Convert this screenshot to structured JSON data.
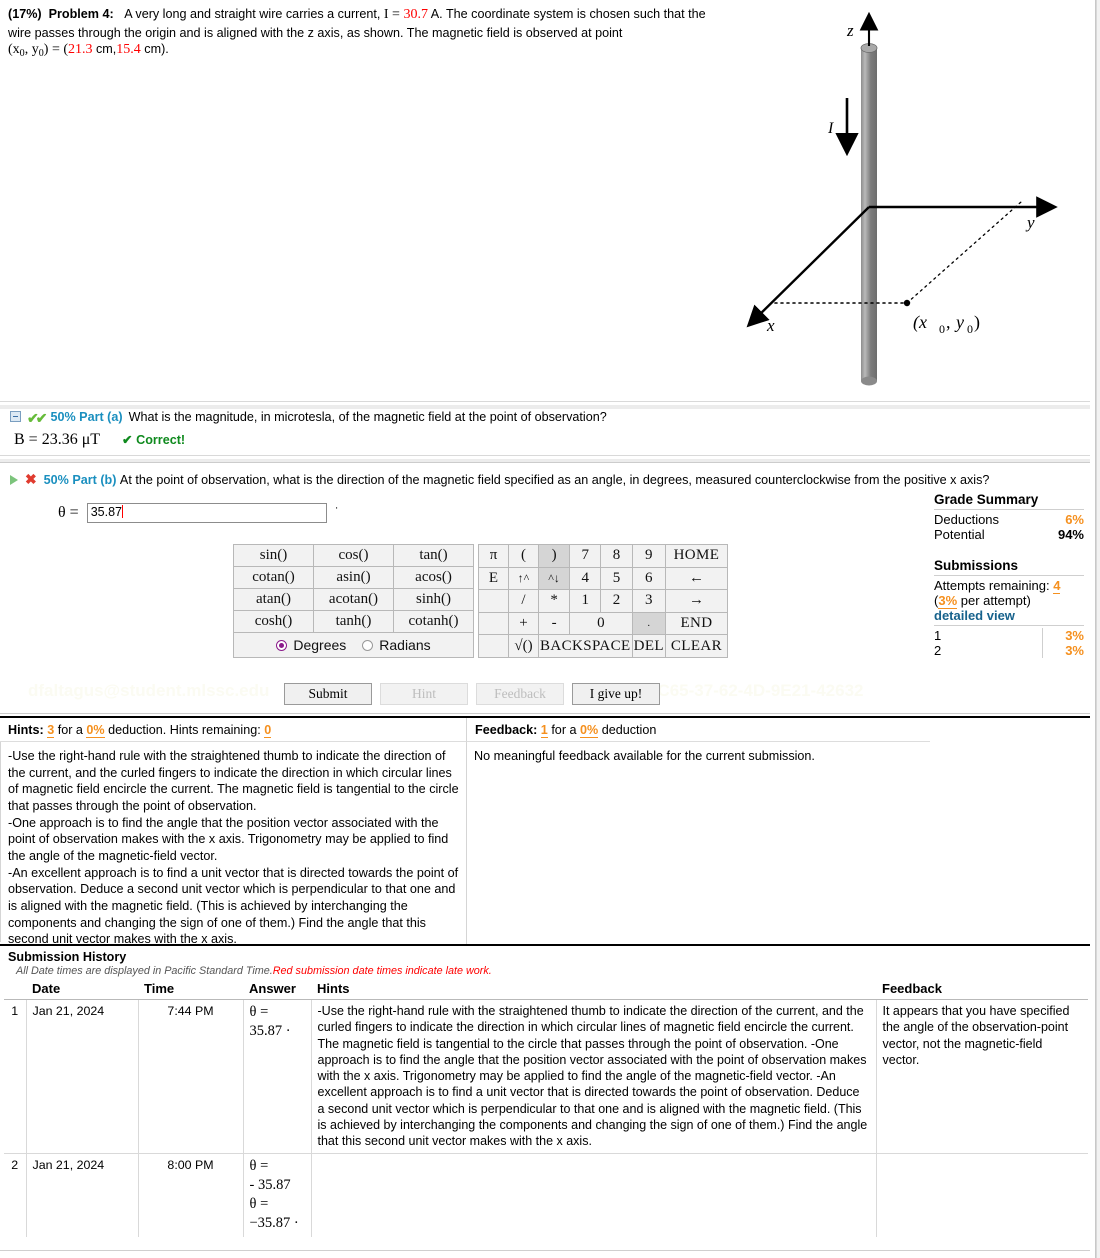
{
  "problem": {
    "weight": "(17%)",
    "label": "Problem 4:",
    "text_1": "A very long and straight wire carries a current,",
    "current_sym": "I",
    "eq": "=",
    "current_value": "30.7",
    "current_unit": "A.",
    "text_2": "The coordinate system is chosen such that the wire passes through the origin and is aligned with the z axis, as shown. The magnetic field is observed at point",
    "point_lhs": "(x0, y0)",
    "point_open": "= (",
    "x0_value": "21.3",
    "x0_unit": "cm,",
    "y0_value": "15.4",
    "y0_unit": "cm).",
    "figure": {
      "axis_z": "z",
      "axis_y": "y",
      "axis_x": "x",
      "current_label": "I",
      "point_label": "(x0, y0)",
      "wire_color": "#8a8a8a"
    }
  },
  "part_a": {
    "percent": "50% Part (a)",
    "question": "What is the magnitude, in microtesla, of the magnetic field at the point of observation?",
    "answer_symbol": "B = 23.36 μT",
    "status": "✔ Correct!",
    "status_color": "#0f8a1e"
  },
  "part_b": {
    "percent": "50% Part (b)",
    "question": "At the point of observation, what is the direction of the magnetic field specified as an angle, in degrees, measured counterclockwise from the positive x axis?",
    "answer_label": "θ =",
    "answer_value": "35.87",
    "answer_placeholder": "",
    "degree_mark": "·"
  },
  "calculator": {
    "functions": [
      [
        "sin()",
        "cos()",
        "tan()"
      ],
      [
        "cotan()",
        "asin()",
        "acos()"
      ],
      [
        "atan()",
        "acotan()",
        "sinh()"
      ],
      [
        "cosh()",
        "tanh()",
        "cotanh()"
      ]
    ],
    "angle_modes": {
      "degrees": "Degrees",
      "radians": "Radians",
      "selected": "Degrees",
      "accent": "#8b1a8b"
    },
    "keypad": [
      [
        "π",
        "(",
        ")",
        "7",
        "8",
        "9",
        "HOME"
      ],
      [
        "E",
        "↑^",
        "^↓",
        "4",
        "5",
        "6",
        "←"
      ],
      [
        "",
        "/",
        "*",
        "1",
        "2",
        "3",
        "→"
      ],
      [
        "",
        "+",
        "-",
        "0",
        "",
        ".",
        "END"
      ],
      [
        "",
        "√()",
        "BACKSPACE",
        "",
        "DEL",
        "CLEAR"
      ]
    ]
  },
  "buttons": {
    "submit": "Submit",
    "hint": "Hint",
    "feedback": "Feedback",
    "give_up": "I give up!"
  },
  "watermarks": {
    "left": "dfaltagus@student.mlssc.edu",
    "right": "6C65-37-62-4D-9E21-42632"
  },
  "grade_summary": {
    "title": "Grade Summary",
    "rows": [
      {
        "label": "Deductions",
        "value": "6%",
        "value_color": "#f5901e"
      },
      {
        "label": "Potential",
        "value": "94%",
        "value_color": "#000000"
      }
    ],
    "submissions_title": "Submissions",
    "attempts_label": "Attempts remaining:",
    "attempts_value": "4",
    "per_attempt_prefix": "(",
    "per_attempt_value": "3%",
    "per_attempt_suffix": " per attempt)",
    "detailed_view": "detailed view",
    "attempt_rows": [
      {
        "num": "1",
        "value": "3%"
      },
      {
        "num": "2",
        "value": "3%"
      }
    ]
  },
  "hints_pane": {
    "label": "Hints:",
    "count": "3",
    "mid_1": "for a",
    "deduction": "0%",
    "mid_2": "deduction. Hints remaining:",
    "remaining": "0",
    "body": "-Use the right-hand rule with the straightened thumb to indicate the direction of the current, and the curled fingers to indicate the direction in which circular lines of magnetic field encircle the current. The magnetic field is tangential to the circle that passes through the point of observation.\n-One approach is to find the angle that the position vector associated with the point of observation makes with the x axis. Trigonometry may be applied to find the angle of the magnetic-field vector.\n-An excellent approach is to find a unit vector that is directed towards the point of observation. Deduce a second unit vector which is perpendicular to that one and is aligned with the magnetic field. (This is achieved by interchanging the components and changing the sign of one of them.) Find the angle that this second unit vector makes with the x axis."
  },
  "feedback_pane": {
    "label": "Feedback:",
    "count": "1",
    "mid_1": "for a",
    "deduction": "0%",
    "mid_2": "deduction",
    "body": "No meaningful feedback available for the current submission."
  },
  "submission_history": {
    "title": "Submission History",
    "note_normal": "All Date times are displayed in Pacific Standard Time.",
    "note_red": "Red submission date times indicate late work.",
    "columns": [
      "",
      "Date",
      "Time",
      "Answer",
      "Hints",
      "Feedback"
    ],
    "rows": [
      {
        "index": "1",
        "date": "Jan 21, 2024",
        "time": "7:44 PM",
        "answer": "θ =\n35.87 ·",
        "hints": "-Use the right-hand rule with the straightened thumb to indicate the direction of the current, and the curled fingers to indicate the direction in which circular lines of magnetic field encircle the current. The magnetic field is tangential to the circle that passes through the point of observation.\n-One approach is to find the angle that the position vector associated with the point of observation makes with the x axis. Trigonometry may be applied to find the angle of the magnetic-field vector.\n-An excellent approach is to find a unit vector that is directed towards the point of observation. Deduce a second unit vector which is perpendicular to that one and is aligned with the magnetic field. (This is achieved by interchanging the components and changing the sign of one of them.) Find the angle that this second unit vector makes with the x axis.",
        "feedback": "It appears that you have specified the angle of the observation-point vector, not the magnetic-field vector."
      },
      {
        "index": "2",
        "date": "Jan 21, 2024",
        "time": "8:00 PM",
        "answer": "θ =\n- 35.87\nθ =\n−35.87 ·",
        "hints": "",
        "feedback": ""
      }
    ]
  }
}
